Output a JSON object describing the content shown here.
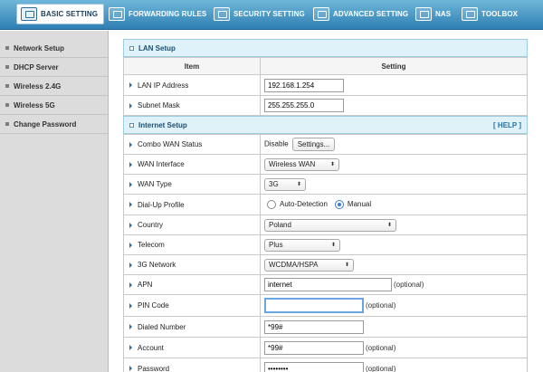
{
  "nav": {
    "tabs": [
      {
        "label": "BASIC SETTING",
        "icon": "basic-setting-icon",
        "active": true
      },
      {
        "label": "FORWARDING RULES",
        "icon": "forwarding-icon"
      },
      {
        "label": "SECURITY SETTING",
        "icon": "security-icon"
      },
      {
        "label": "ADVANCED SETTING",
        "icon": "advanced-icon"
      },
      {
        "label": "NAS",
        "icon": "nas-icon"
      },
      {
        "label": "TOOLBOX",
        "icon": "toolbox-icon"
      }
    ]
  },
  "sidebar": {
    "items": [
      {
        "label": "Network Setup"
      },
      {
        "label": "DHCP Server"
      },
      {
        "label": "Wireless 2.4G"
      },
      {
        "label": "Wireless 5G"
      },
      {
        "label": "Change Password"
      }
    ]
  },
  "lan": {
    "title": "LAN Setup",
    "col_item": "Item",
    "col_setting": "Setting",
    "ip_label": "LAN IP Address",
    "ip_value": "192.168.1.254",
    "mask_label": "Subnet Mask",
    "mask_value": "255.255.255.0"
  },
  "internet": {
    "title": "Internet Setup",
    "help": "[ HELP ]",
    "combo_label": "Combo WAN Status",
    "combo_value": "Disable",
    "settings_button": "Settings...",
    "wan_iface_label": "WAN Interface",
    "wan_iface_value": "Wireless WAN",
    "wan_type_label": "WAN Type",
    "wan_type_value": "3G",
    "dialup_label": "Dial-Up Profile",
    "dialup_auto": "Auto-Detection",
    "dialup_manual": "Manual",
    "country_label": "Country",
    "country_value": "Poland",
    "telecom_label": "Telecom",
    "telecom_value": "Plus",
    "network_label": "3G Network",
    "network_value": "WCDMA/HSPA",
    "apn_label": "APN",
    "apn_value": "internet",
    "optional": "(optional)",
    "pin_label": "PIN Code",
    "pin_value": "",
    "dialed_label": "Dialed Number",
    "dialed_value": "*99#",
    "account_label": "Account",
    "account_value": "*99#",
    "password_label": "Password",
    "password_value": "••••••••"
  },
  "colors": {
    "accent": "#2f7fb3",
    "section_bg": "#dff1f9",
    "sidebar_bg": "#dcdcdc"
  }
}
